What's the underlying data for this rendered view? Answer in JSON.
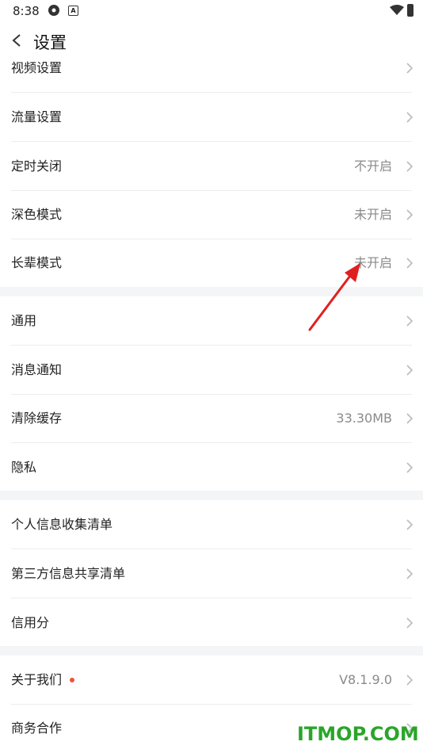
{
  "status_bar": {
    "time": "8:38"
  },
  "header": {
    "title": "设置"
  },
  "groups": [
    {
      "items": [
        {
          "label": "视频设置",
          "value": ""
        },
        {
          "label": "流量设置",
          "value": ""
        },
        {
          "label": "定时关闭",
          "value": "不开启"
        },
        {
          "label": "深色模式",
          "value": "未开启"
        },
        {
          "label": "长辈模式",
          "value": "未开启"
        }
      ]
    },
    {
      "items": [
        {
          "label": "通用",
          "value": ""
        },
        {
          "label": "消息通知",
          "value": ""
        },
        {
          "label": "清除缓存",
          "value": "33.30MB"
        },
        {
          "label": "隐私",
          "value": ""
        }
      ]
    },
    {
      "items": [
        {
          "label": "个人信息收集清单",
          "value": ""
        },
        {
          "label": "第三方信息共享清单",
          "value": ""
        },
        {
          "label": "信用分",
          "value": ""
        }
      ]
    },
    {
      "items": [
        {
          "label": "关于我们",
          "value": "V8.1.9.0",
          "badge": "red-dot"
        },
        {
          "label": "商务合作",
          "value": ""
        }
      ]
    }
  ],
  "watermark": "ITMOP.COM",
  "colors": {
    "accent_dot": "#f0503c",
    "watermark": "#2aa52a",
    "arrow": "#e02020"
  }
}
